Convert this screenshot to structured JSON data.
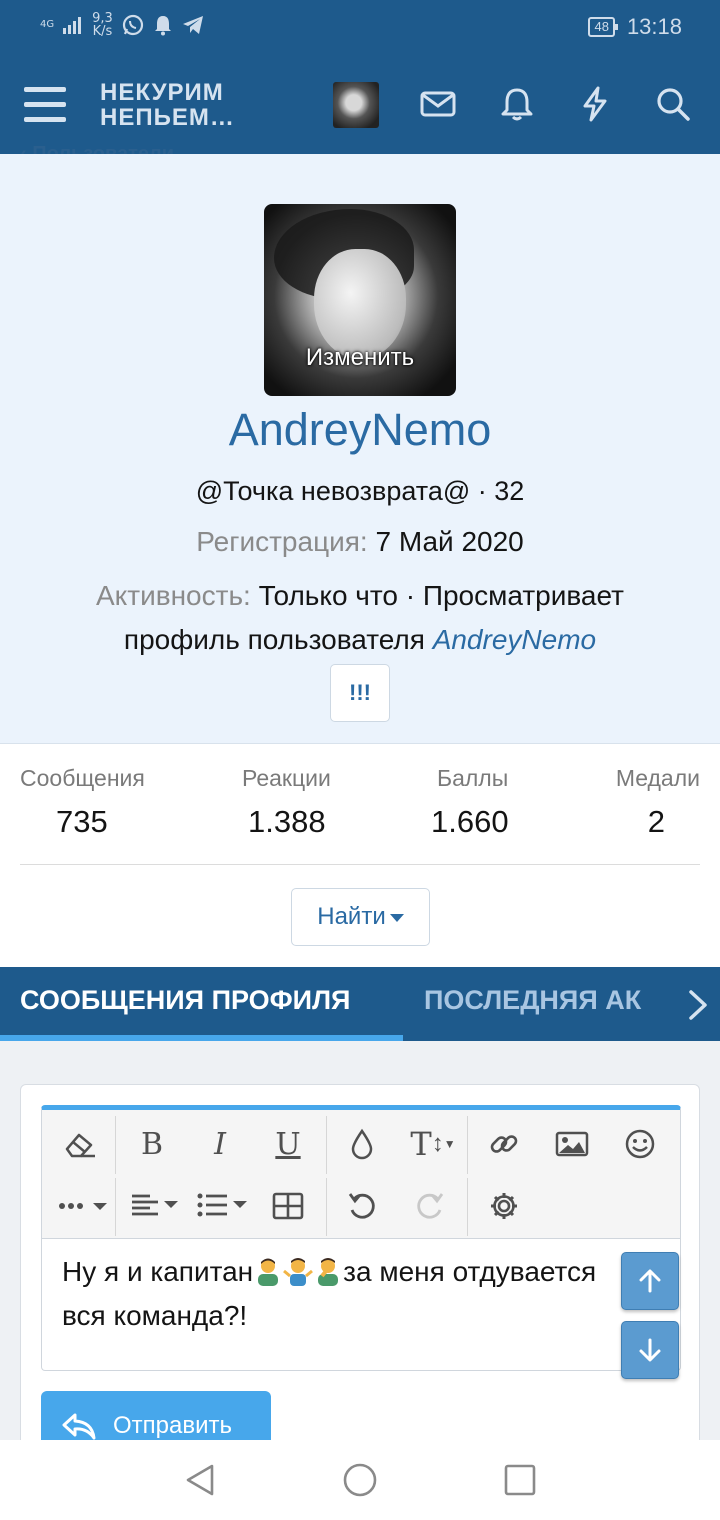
{
  "status_bar": {
    "network": "4G",
    "speed_value": "9,3",
    "speed_unit": "K/s",
    "battery": "48",
    "time": "13:18"
  },
  "header": {
    "logo_line1": "НЕКУРИМ",
    "logo_line2": "НЕПЬЕМ…"
  },
  "breadcrumb": "Пользователи",
  "profile": {
    "avatar_action": "Изменить",
    "username": "AndreyNemo",
    "user_title": "@Точка невозврата@ · 32",
    "registration_label": "Регистрация:",
    "registration_date": "7 Май 2020",
    "activity_label": "Активность:",
    "activity_text": "Только что · Просматривает профиль пользователя",
    "activity_user": "AndreyNemo",
    "more_button": "!!!"
  },
  "stats": [
    {
      "label": "Сообщения",
      "value": "735"
    },
    {
      "label": "Реакции",
      "value": "1.388"
    },
    {
      "label": "Баллы",
      "value": "1.660"
    },
    {
      "label": "Медали",
      "value": "2"
    }
  ],
  "find_button": "Найти",
  "tabs": [
    {
      "label": "СООБЩЕНИЯ ПРОФИЛЯ",
      "active": true
    },
    {
      "label": "ПОСЛЕДНЯЯ АК",
      "active": false
    }
  ],
  "editor": {
    "text_part1": "Ну я и капитан",
    "text_part2": "за меня отдувается вся команда?!",
    "send_button": "Отправить"
  },
  "colors": {
    "brand": "#1e5a8c",
    "accent": "#47a7eb",
    "link": "#2a6aa3",
    "profile_bg": "#ebf3fc"
  }
}
